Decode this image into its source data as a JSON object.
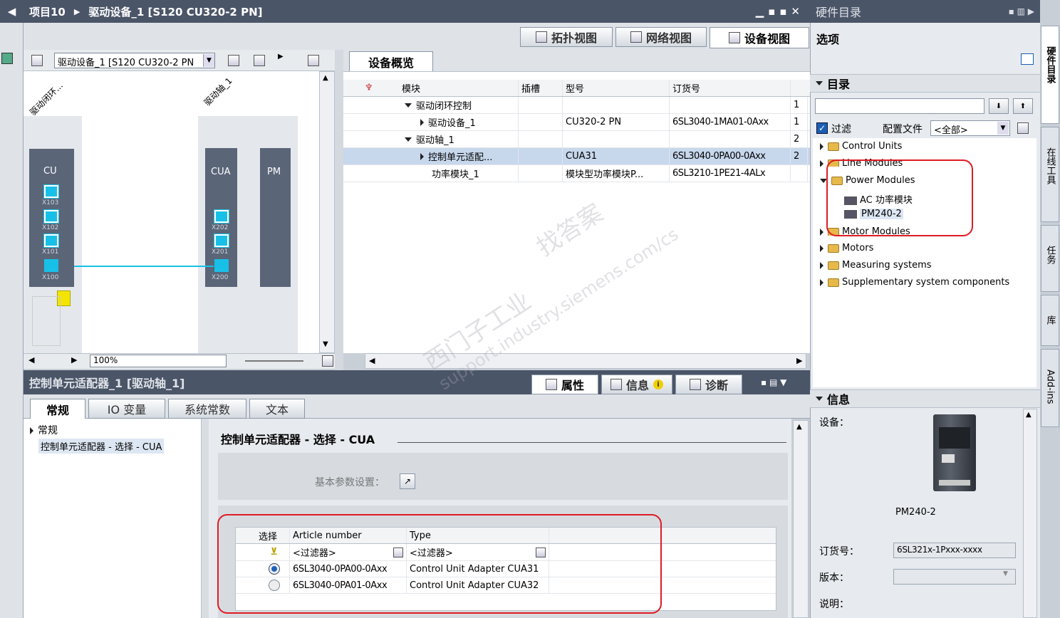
{
  "title_bar": {
    "breadcrumb_1": "项目10",
    "breadcrumb_2": "驱动设备_1 [S120 CU320-2 PN]"
  },
  "view_tabs": {
    "topology": "拓扑视图",
    "network": "网络视图",
    "device": "设备视图"
  },
  "device_toolbar": {
    "device_select": "驱动设备_1 [S120 CU320-2 PN",
    "zoom": "100%"
  },
  "canvas": {
    "rotated_1": "驱动闭环...",
    "rotated_2": "驱动轴_1",
    "cu": "CU",
    "cua": "CUA",
    "pm": "PM",
    "cu_ports": [
      "X103",
      "X102",
      "X101",
      "X100"
    ],
    "cua_ports": [
      "X202",
      "X201",
      "X200"
    ]
  },
  "overview": {
    "tab": "设备概览",
    "headers": [
      "模块",
      "插槽",
      "型号",
      "订货号"
    ],
    "rows": [
      {
        "name": "驱动闭环控制",
        "slot": "",
        "model": "",
        "order": "",
        "last": "1"
      },
      {
        "name": "驱动设备_1",
        "slot": "",
        "model": "CU320-2 PN",
        "order": "6SL3040-1MA01-0Axx",
        "last": "1"
      },
      {
        "name": "驱动轴_1",
        "slot": "",
        "model": "",
        "order": "",
        "last": "2"
      },
      {
        "name": "控制单元适配...",
        "slot": "",
        "model": "CUA31",
        "order": "6SL3040-0PA00-0Axx",
        "last": "2"
      },
      {
        "name": "功率模块_1",
        "slot": "",
        "model": "模块型功率模块P...",
        "order": "6SL3210-1PE21-4ALx",
        "last": ""
      }
    ]
  },
  "props": {
    "title": "控制单元适配器_1 [驱动轴_1]",
    "tab_props": "属性",
    "tab_info": "信息",
    "tab_diag": "诊断",
    "subtabs": [
      "常规",
      "IO 变量",
      "系统常数",
      "文本"
    ],
    "nav_group": "常规",
    "nav_item": "控制单元适配器 - 选择 - CUA",
    "section_title": "控制单元适配器 - 选择 - CUA",
    "basic_param": "基本参数设置：",
    "table_headers": [
      "选择",
      "Article number",
      "Type"
    ],
    "filter": "<过滤器>",
    "rows": [
      {
        "article": "6SL3040-0PA00-0Axx",
        "type": "Control Unit Adapter CUA31",
        "selected": true
      },
      {
        "article": "6SL3040-0PA01-0Axx",
        "type": "Control Unit Adapter CUA32",
        "selected": false
      }
    ]
  },
  "catalog": {
    "panel_title": "硬件目录",
    "options": "选项",
    "catalog_title": "目录",
    "filter_label": "过滤",
    "profile_label": "配置文件",
    "profile_value": "<全部>",
    "tree": [
      "Control Units",
      "Line Modules",
      "Power Modules",
      "AC 功率模块",
      "PM240-2",
      "Motor Modules",
      "Motors",
      "Measuring systems",
      "Supplementary system components"
    ]
  },
  "info": {
    "title": "信息",
    "device_label": "设备：",
    "device_name": "PM240-2",
    "order_label": "订货号：",
    "order_value": "6SL321x-1Pxxx-xxxx",
    "version_label": "版本：",
    "desc_label": "说明："
  },
  "side_tabs": [
    "硬件目录",
    "在线工具",
    "任务",
    "库",
    "Add-ins"
  ],
  "watermark": {
    "line1": "西门子工业",
    "line2": "找答案",
    "line3": "support.industry.siemens.com/cs"
  },
  "colors": {
    "accent": "#18c0e8",
    "title_bar": "#4b5568",
    "highlight": "#e01b24"
  }
}
